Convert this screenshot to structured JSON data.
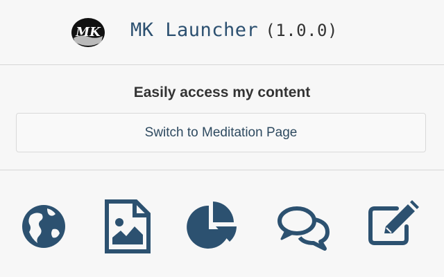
{
  "header": {
    "title": "MK Launcher",
    "version": "(1.0.0)",
    "logo_text": "MK"
  },
  "content": {
    "title": "Easily access my content",
    "switch_button_label": "Switch to Meditation Page"
  },
  "icons": [
    {
      "name": "globe-icon"
    },
    {
      "name": "image-icon"
    },
    {
      "name": "pie-chart-icon"
    },
    {
      "name": "chat-icon"
    },
    {
      "name": "edit-icon"
    }
  ],
  "colors": {
    "icon": "#2c5170",
    "title": "#2c5070",
    "background": "#f7f7f7"
  }
}
